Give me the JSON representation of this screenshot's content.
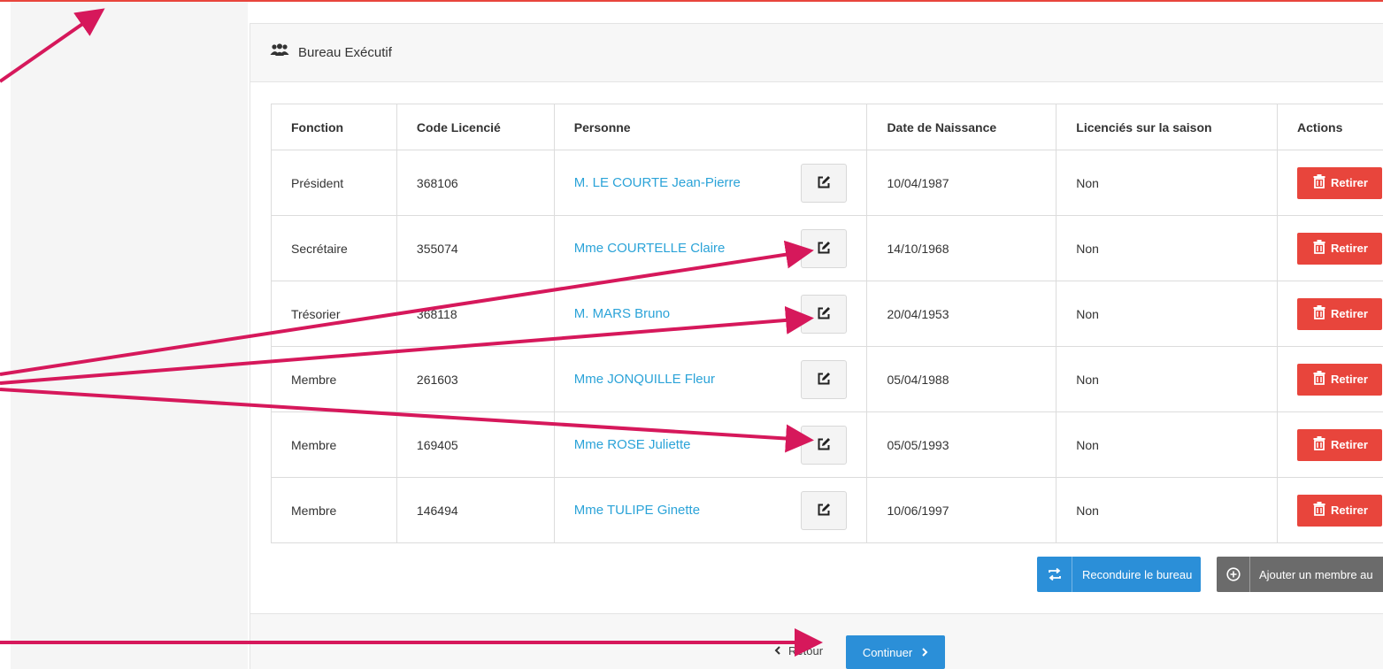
{
  "panel": {
    "title": "Bureau Exécutif",
    "title_icon": "users-icon"
  },
  "table": {
    "headers": [
      "Fonction",
      "Code Licencié",
      "Personne",
      "Date de Naissance",
      "Licenciés sur la saison",
      "Actions"
    ],
    "rows": [
      {
        "fonction": "Président",
        "code": "368106",
        "personne": "M. LE COURTE Jean-Pierre",
        "naissance": "10/04/1987",
        "licencie": "Non",
        "action": "Retirer"
      },
      {
        "fonction": "Secrétaire",
        "code": "355074",
        "personne": "Mme COURTELLE Claire",
        "naissance": "14/10/1968",
        "licencie": "Non",
        "action": "Retirer"
      },
      {
        "fonction": "Trésorier",
        "code": "368118",
        "personne": "M. MARS Bruno",
        "naissance": "20/04/1953",
        "licencie": "Non",
        "action": "Retirer"
      },
      {
        "fonction": "Membre",
        "code": "261603",
        "personne": "Mme JONQUILLE Fleur",
        "naissance": "05/04/1988",
        "licencie": "Non",
        "action": "Retirer"
      },
      {
        "fonction": "Membre",
        "code": "169405",
        "personne": "Mme ROSE Juliette",
        "naissance": "05/05/1993",
        "licencie": "Non",
        "action": "Retirer"
      },
      {
        "fonction": "Membre",
        "code": "146494",
        "personne": "Mme TULIPE Ginette",
        "naissance": "10/06/1997",
        "licencie": "Non",
        "action": "Retirer"
      }
    ]
  },
  "buttons": {
    "renew": "Reconduire le bureau",
    "add_member": "Ajouter un membre au",
    "back": "Retour",
    "continue": "Continuer"
  },
  "colors": {
    "accent_blue": "#2b8fd8",
    "link_blue": "#2ba3d8",
    "danger_red": "#e8453c",
    "annotation_magenta": "#d6185b",
    "neutral_gray": "#6b6b6b"
  }
}
